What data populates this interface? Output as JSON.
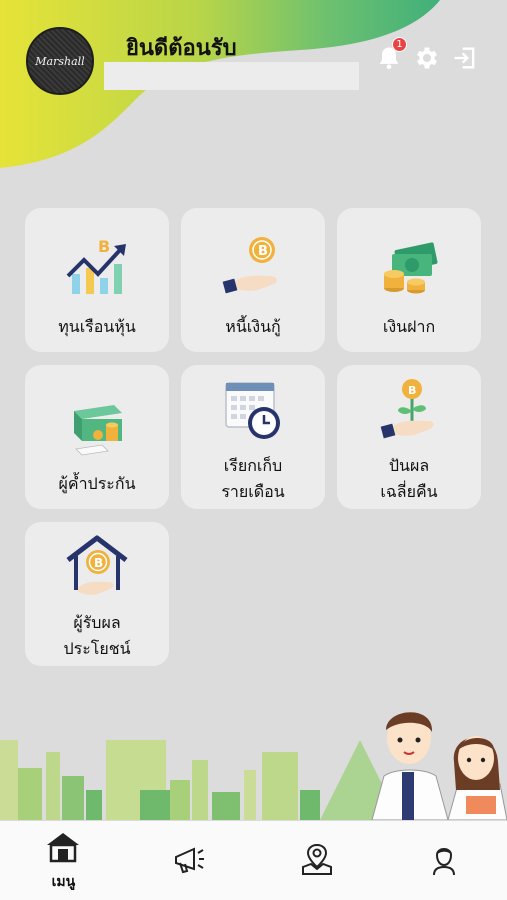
{
  "header": {
    "avatar_text": "Marshall",
    "greeting": "ยินดีต้อนรับ",
    "notification_count": "1",
    "icons": [
      "bell-icon",
      "gear-icon",
      "logout-icon"
    ]
  },
  "menu": [
    {
      "label": "ทุนเรือนหุ้น",
      "icon": "stock-growth-icon"
    },
    {
      "label": "หนี้เงินกู้",
      "icon": "loan-coin-icon"
    },
    {
      "label": "เงินฝาก",
      "icon": "deposit-money-icon"
    },
    {
      "label": "ผู้ค้ำประกัน",
      "icon": "guarantor-icon"
    },
    {
      "label_line1": "เรียกเก็บ",
      "label_line2": "รายเดือน",
      "icon": "calendar-clock-icon"
    },
    {
      "label_line1": "ปันผล",
      "label_line2": "เฉลี่ยคืน",
      "icon": "dividend-plant-icon"
    },
    {
      "label_line1": "ผู้รับผล",
      "label_line2": "ประโยชน์",
      "icon": "beneficiary-house-icon"
    }
  ],
  "bottom_nav": {
    "home_label": "เมนู",
    "icons": [
      "home-icon",
      "megaphone-icon",
      "map-pin-icon",
      "profile-icon"
    ]
  },
  "colors": {
    "header_yellow": "#dfe43a",
    "header_green": "#4fb36b",
    "coin": "#f0b23d",
    "navy": "#27336b"
  }
}
